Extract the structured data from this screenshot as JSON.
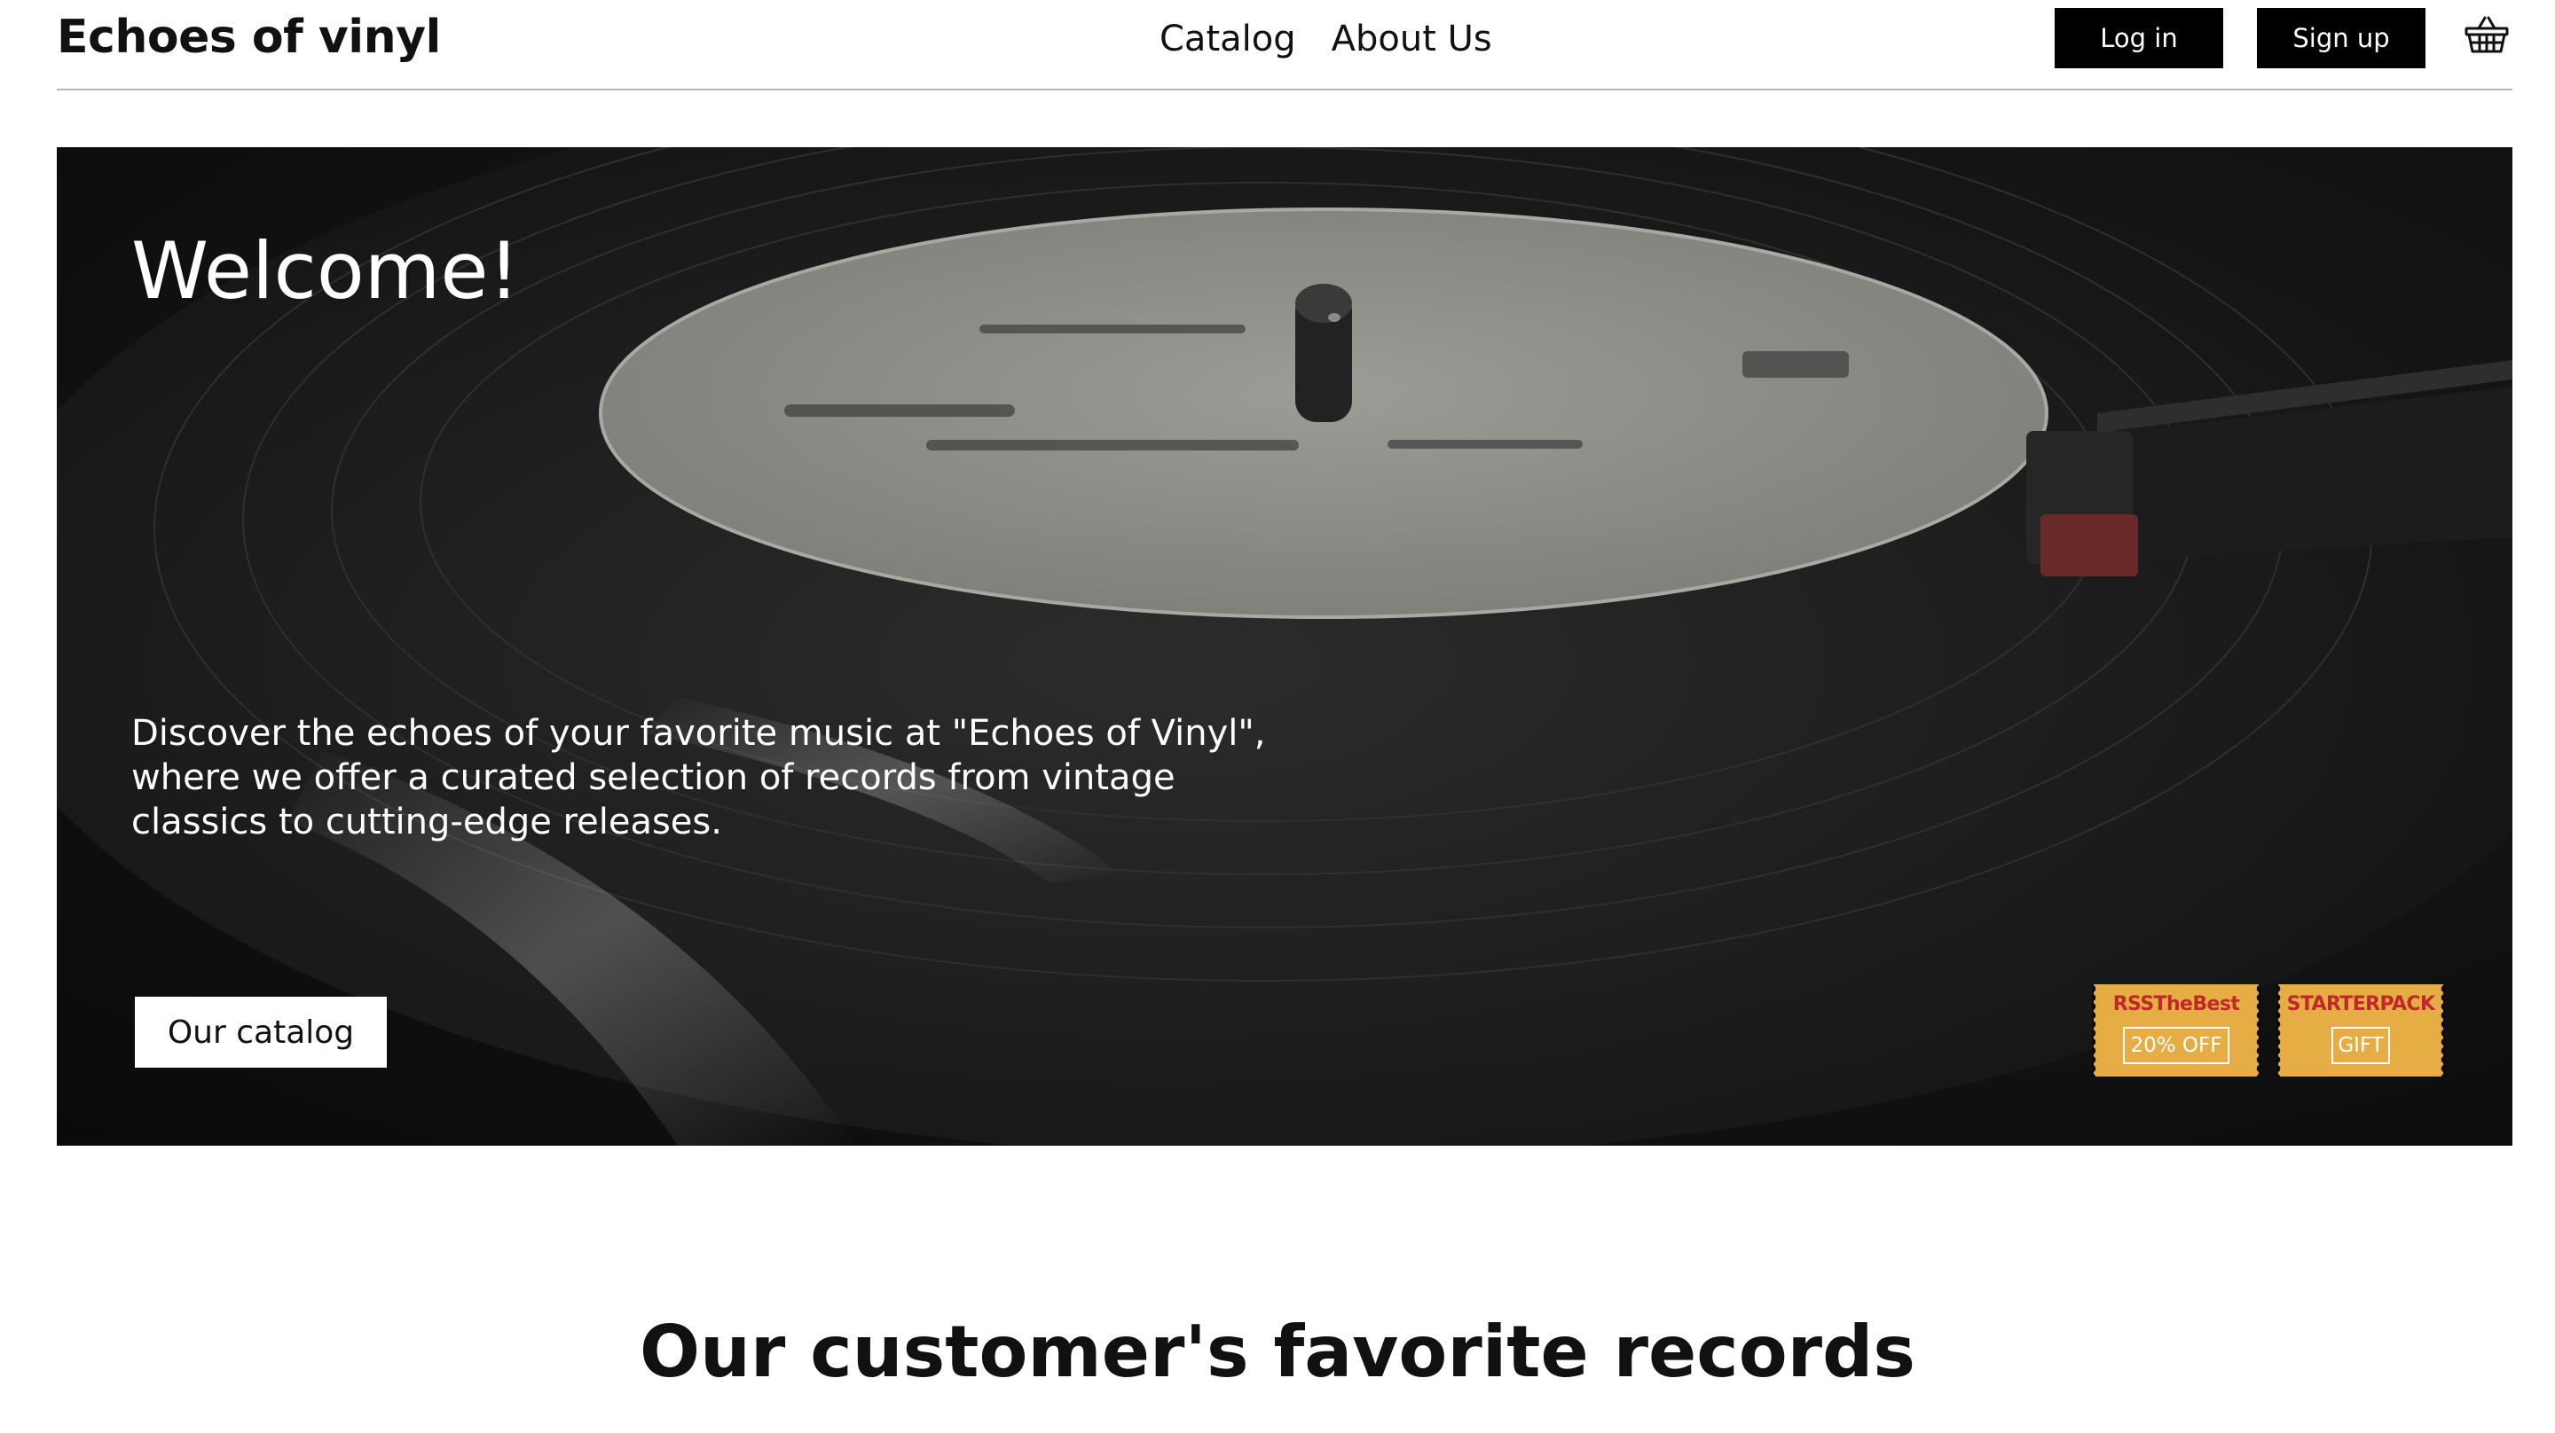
{
  "header": {
    "logo": "Echoes of vinyl",
    "nav": [
      "Catalog",
      "About Us"
    ],
    "login_label": "Log in",
    "signup_label": "Sign up",
    "cart_icon": "basket-icon"
  },
  "hero": {
    "title": "Welcome!",
    "description": "Discover the echoes of your favorite music at \"Echoes of Vinyl\", where we offer a curated selection of records from vintage classics to cutting-edge releases.",
    "catalog_button": "Our catalog",
    "image": "vinyl-turntable-image",
    "coupons": [
      {
        "code": "RSSTheBest",
        "offer": "20% OFF"
      },
      {
        "code": "STARTERPACK",
        "offer": "GIFT"
      }
    ]
  },
  "section": {
    "title": "Our customer's favorite records"
  },
  "colors": {
    "coupon_bg": "#e7ad45",
    "coupon_code": "#c0282a",
    "button_dark": "#000000"
  }
}
